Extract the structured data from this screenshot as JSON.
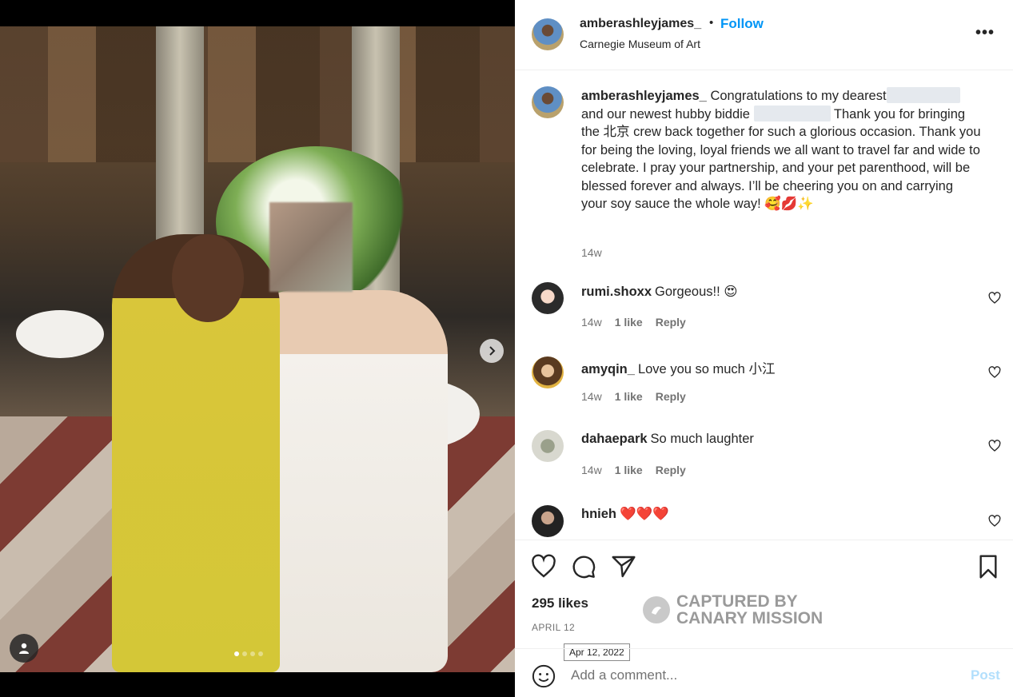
{
  "post": {
    "author": "amberashleyjames_",
    "bullet": "•",
    "follow_label": "Follow",
    "location": "Carnegie Museum of Art",
    "more_label": "•••"
  },
  "caption": {
    "username": "amberashleyjames_",
    "part1": "Congratulations to my dearest",
    "part2": "and our newest hubby biddie",
    "part3": "Thank you for bringing the 北京 crew back together for such a glorious occasion. Thank you for being the loving, loyal friends we all want to travel far and wide to celebrate. I pray your partnership, and your pet parenthood, will be blessed forever and always. I’ll be cheering you on and carrying your soy sauce the whole way!",
    "emojis": "🥰💋✨",
    "time": "14w"
  },
  "comments": [
    {
      "username": "rumi.shoxx",
      "text": "Gorgeous!! 😍",
      "time": "14w",
      "likes": "1 like",
      "reply": "Reply"
    },
    {
      "username": "amyqin_",
      "text": "Love you so much 小江",
      "time": "14w",
      "likes": "1 like",
      "reply": "Reply"
    },
    {
      "username": "dahaepark",
      "text": "So much laughter",
      "time": "14w",
      "likes": "1 like",
      "reply": "Reply"
    },
    {
      "username": "hnieh",
      "text": "❤️❤️❤️"
    }
  ],
  "actions": {
    "likes": "295 likes",
    "date": "APRIL 12",
    "tooltip": "Apr 12, 2022"
  },
  "watermark": {
    "line1": "CAPTURED BY",
    "line2": "CANARY MISSION"
  },
  "comment_bar": {
    "placeholder": "Add a comment...",
    "post_label": "Post"
  },
  "colors": {
    "accent": "#0095f6",
    "text": "#262626",
    "secondary": "#737373",
    "post_disabled": "#b2dffc"
  },
  "icons": [
    "chevron-right-icon",
    "user-tag-icon",
    "more-icon",
    "heart-icon",
    "comment-icon",
    "share-icon",
    "bookmark-icon",
    "emoji-icon"
  ]
}
